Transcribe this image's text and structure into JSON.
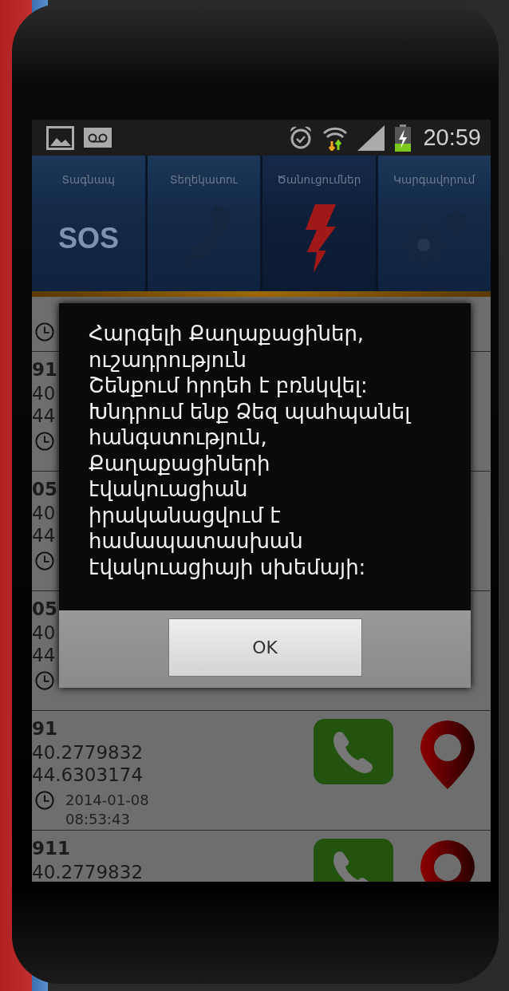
{
  "status_bar": {
    "time": "20:59"
  },
  "tabs": [
    {
      "label": "Տագնապ",
      "icon_text": "SOS",
      "selected": false
    },
    {
      "label": "Տեղեկատու",
      "selected": false
    },
    {
      "label": "Ծանուցումներ",
      "selected": true
    },
    {
      "label": "Կարգավորում",
      "selected": false
    }
  ],
  "list": {
    "rows": [
      {
        "partial": true,
        "clock": true
      },
      {
        "number": "91",
        "lat": "40",
        "lon": "44",
        "clock": true
      },
      {
        "number": "05",
        "lat": "40",
        "lon": "44",
        "clock": true
      },
      {
        "number": "05",
        "lat": "40",
        "lon": "44",
        "clock": true
      },
      {
        "number": "91",
        "lat": "40.2779832",
        "lon": "44.6303174",
        "clock": true,
        "date": "2014-01-08",
        "time": "08:53:43",
        "actions": true
      },
      {
        "number": "911",
        "lat": "40.2779832",
        "actions": true
      }
    ]
  },
  "dialog": {
    "message": "Հարգելի Քաղաքացիներ,\nուշադրություն\nՇենքում հրդեհ է բռնկվել:\nԽնդրում ենք Ձեզ պահպանել\nհանգստություն,\nՔաղաքացիների\nէվակուացիան\nիրականացվում է\nհամապատասխան\nէվակուացիայի սխեմայի:",
    "button": "OK"
  }
}
